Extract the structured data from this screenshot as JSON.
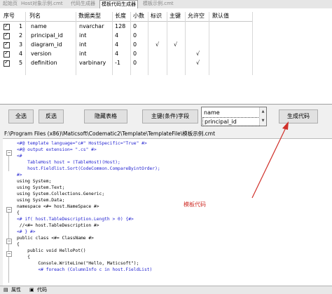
{
  "tabs": [
    {
      "label": "起始页"
    },
    {
      "label": "Host对象示例.cmt"
    },
    {
      "label": "代码生成器"
    },
    {
      "label": "模板代码生成器",
      "active": true
    },
    {
      "label": "模板示例.cmt"
    }
  ],
  "grid": {
    "columns": [
      "序号",
      "列名",
      "数据类型",
      "长度",
      "小数",
      "标识",
      "主键",
      "允许空",
      "默认值"
    ],
    "rows": [
      {
        "checked": true,
        "num": "1",
        "name": "name",
        "type": "nvarchar",
        "length": "128",
        "decimal": "0",
        "identity": "",
        "pk": "",
        "nullable": ""
      },
      {
        "checked": true,
        "num": "2",
        "name": "principal_id",
        "type": "int",
        "length": "4",
        "decimal": "0",
        "identity": "",
        "pk": "",
        "nullable": ""
      },
      {
        "checked": true,
        "num": "3",
        "name": "diagram_id",
        "type": "int",
        "length": "4",
        "decimal": "0",
        "identity": "√",
        "pk": "√",
        "nullable": ""
      },
      {
        "checked": true,
        "num": "4",
        "name": "version",
        "type": "int",
        "length": "4",
        "decimal": "0",
        "identity": "",
        "pk": "",
        "nullable": "√"
      },
      {
        "checked": true,
        "num": "5",
        "name": "definition",
        "type": "varbinary",
        "length": "-1",
        "decimal": "0",
        "identity": "",
        "pk": "",
        "nullable": "√"
      }
    ]
  },
  "toolbar": {
    "select_all": "全选",
    "invert": "反选",
    "hide_table": "隐藏表格",
    "pk_fields": "主键(条件)字段",
    "generate": "生成代码",
    "pk_list": [
      "name",
      "principal_id"
    ]
  },
  "template_path": "F:\\Program Files (x86)\\Maticsoft\\Codematic2\\Template\\TemplateFile\\模板示例.cmt",
  "code_lines": [
    {
      "text": "<#@ template language=\"c#\" HostSpecific=\"True\" #>",
      "color": "#1f1fd0",
      "indent": 0
    },
    {
      "text": "<#@ output extension= \".cs\" #>",
      "color": "#1f1fd0",
      "indent": 0
    },
    {
      "text": "<#",
      "color": "#1f1fd0",
      "indent": 0
    },
    {
      "text": "    TableHost host = (TableHost)(Host);",
      "color": "#1f1fd0",
      "indent": 0
    },
    {
      "text": "    host.Fieldlist.Sort(CodeCommon.CompareByintOrder);",
      "color": "#1f1fd0",
      "indent": 0
    },
    {
      "text": "#>",
      "color": "#1f1fd0",
      "indent": 0
    },
    {
      "text": "using System;",
      "color": "#000000",
      "indent": 0
    },
    {
      "text": "using System.Text;",
      "color": "#000000",
      "indent": 0
    },
    {
      "text": "using System.Collections.Generic;",
      "color": "#000000",
      "indent": 0
    },
    {
      "text": "using System.Data;",
      "color": "#000000",
      "indent": 0
    },
    {
      "text": "namespace <#= host.NameSpace #>",
      "color": "#000000",
      "indent": 0
    },
    {
      "text": "{",
      "color": "#000000",
      "indent": 0
    },
    {
      "text": "<# if( host.TableDescription.Length > 0) {#>",
      "color": "#1f1fd0",
      "indent": 0
    },
    {
      "text": " //<#= host.TableDescription #>",
      "color": "#000000",
      "indent": 0
    },
    {
      "text": "<# } #>",
      "color": "#1f1fd0",
      "indent": 0
    },
    {
      "text": "public class <#= ClassName #>",
      "color": "#000000",
      "indent": 0
    },
    {
      "text": "{",
      "color": "#000000",
      "indent": 0
    },
    {
      "text": "    public void HelloPot()",
      "color": "#000000",
      "indent": 0
    },
    {
      "text": "    {",
      "color": "#000000",
      "indent": 0
    },
    {
      "text": "        Console.WriteLine(\"Hello, Maticsoft\");",
      "color": "#000000",
      "indent": 0
    },
    {
      "text": "        <# foreach (ColumnInfo c in host.FieldList)",
      "color": "#1f1fd0",
      "indent": 0
    }
  ],
  "annotation": "模板代码",
  "annotation_color": "#d0302a",
  "bottom_tabs": [
    "属性",
    "代码"
  ]
}
